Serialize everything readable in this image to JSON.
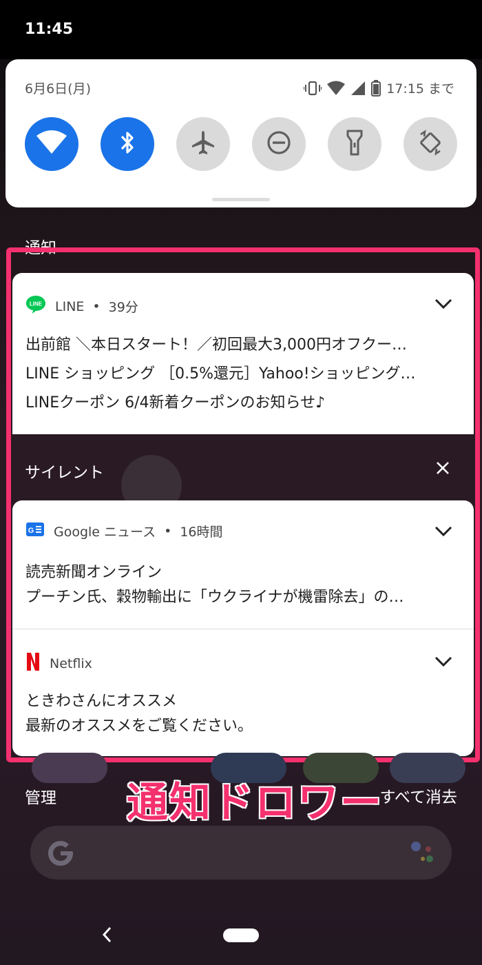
{
  "status_bar": {
    "time": "11:45"
  },
  "quick_settings": {
    "date": "6月6日(月)",
    "battery_until": "17:15 まで",
    "tiles": [
      {
        "name": "wifi",
        "state": "on"
      },
      {
        "name": "bluetooth",
        "state": "on"
      },
      {
        "name": "airplane",
        "state": "off"
      },
      {
        "name": "do-not-disturb",
        "state": "off"
      },
      {
        "name": "flashlight",
        "state": "off"
      },
      {
        "name": "auto-rotate",
        "state": "off"
      }
    ]
  },
  "notifications": {
    "section_label": "通知",
    "line": {
      "app": "LINE",
      "badge_text": "LINE",
      "time": "39分",
      "lines": [
        "出前館 ＼本日スタート！／初回最大3,000円オフクー…",
        "LINE ショッピング ［0.5%還元］Yahoo!ショッピング…",
        "LINEクーポン 6/4新着クーポンのお知らせ♪"
      ]
    },
    "silent_label": "サイレント",
    "google_news": {
      "app": "Google ニュース",
      "time": "16時間",
      "title": "読売新聞オンライン",
      "text": "プーチン氏、穀物輸出に「ウクライナが機雷除去」の…"
    },
    "netflix": {
      "app": "Netflix",
      "title": "ときわさんにオススメ",
      "text": "最新のオススメをご覧ください。"
    }
  },
  "footer": {
    "manage": "管理",
    "clear_all": "すべて消去"
  },
  "caption": "通知ドロワー",
  "colors": {
    "accent": "#1a73e8",
    "highlight": "#f4306e",
    "line_green": "#06c755",
    "netflix_red": "#e50914"
  }
}
